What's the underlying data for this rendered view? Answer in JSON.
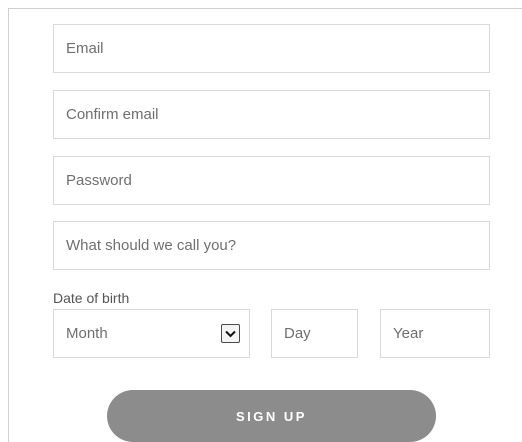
{
  "form": {
    "email": {
      "placeholder": "Email",
      "value": ""
    },
    "confirm_email": {
      "placeholder": "Confirm email",
      "value": ""
    },
    "password": {
      "placeholder": "Password",
      "value": ""
    },
    "display_name": {
      "placeholder": "What should we call you?",
      "value": ""
    },
    "dob": {
      "label": "Date of birth",
      "month": {
        "selected": "Month"
      },
      "day": {
        "placeholder": "Day"
      },
      "year": {
        "placeholder": "Year"
      }
    },
    "submit_label": "SIGN UP"
  },
  "colors": {
    "button_bg": "#8c8c8c",
    "border": "#d9d9d9",
    "placeholder_text": "#6f6f6f"
  },
  "icons": {
    "month_dropdown": "chevron-down-icon"
  }
}
